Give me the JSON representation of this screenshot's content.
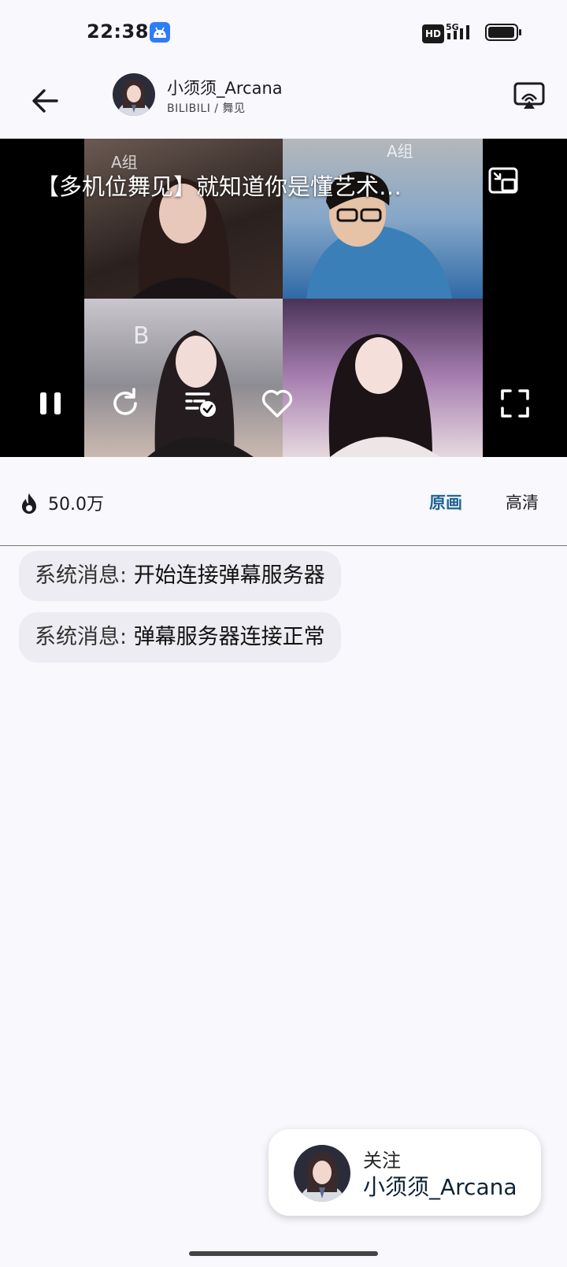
{
  "status_bar": {
    "time": "22:38",
    "hd_badge": "HD",
    "network": "5G"
  },
  "header": {
    "streamer_name": "小须须_Arcana",
    "subtitle": "BILIBILI / 舞见"
  },
  "video": {
    "title": "【多机位舞见】就知道你是懂艺术…",
    "quadrant_labels": [
      "A组",
      "A组",
      "B"
    ]
  },
  "info": {
    "views": "50.0万",
    "quality_options": [
      {
        "label": "原画",
        "selected": true
      },
      {
        "label": "高清",
        "selected": false
      }
    ]
  },
  "messages": [
    {
      "prefix": "系统消息: ",
      "text": "开始连接弹幕服务器"
    },
    {
      "prefix": "系统消息: ",
      "text": "弹幕服务器连接正常"
    }
  ],
  "follow_card": {
    "label": "关注",
    "name": "小须须_Arcana"
  },
  "colors": {
    "background": "#f8f8fd",
    "accent": "#1f6392",
    "message_bubble": "#ececf2"
  }
}
